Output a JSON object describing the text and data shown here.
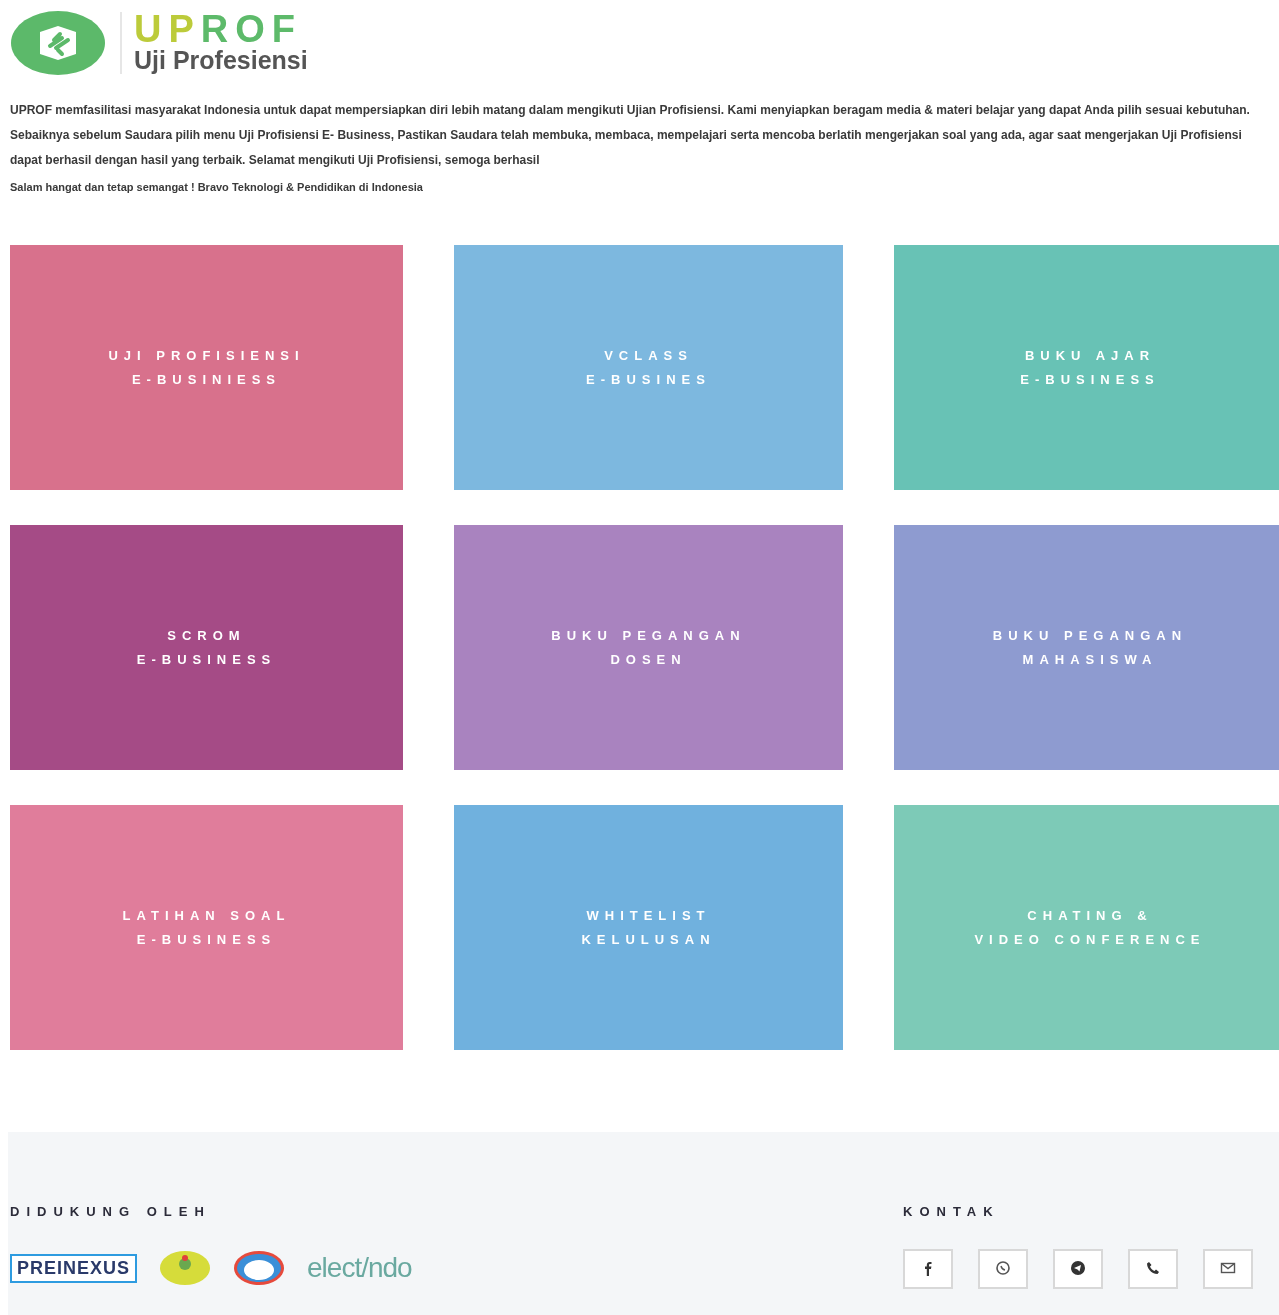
{
  "header": {
    "brand_parts": [
      {
        "text": "UP",
        "color": "#bccb3a"
      },
      {
        "text": "ROF",
        "color": "#5dba6a"
      }
    ],
    "tagline": "Uji Profesiensi"
  },
  "intro": {
    "paragraph": "**UPROF** memfasilitasi masyarakat Indonesia untuk dapat mempersiapkan diri lebih matang dalam mengikuti Ujian Profisiensi. Kami menyiapkan beragam media & materi belajar yang dapat Anda pilih sesuai kebutuhan. Sebaiknya sebelum Saudara pilih menu Uji Profisiensi E- Business, Pastikan Saudara telah membuka, membaca, mempelajari serta mencoba berlatih mengerjakan soal yang ada, agar saat mengerjakan Uji Profisiensi dapat berhasil dengan hasil yang terbaik. Selamat mengikuti Uji Profisiensi, semoga berhasil",
    "greeting": "Salam hangat dan tetap semangat ! Bravo Teknologi & Pendidikan di Indonesia"
  },
  "tiles": [
    {
      "lines": [
        "UJI PROFISIENSI",
        "E-BUSINIESS"
      ],
      "color": "#d8718c"
    },
    {
      "lines": [
        "VCLASS",
        "E-BUSINES"
      ],
      "color": "#7db8df"
    },
    {
      "lines": [
        "BUKU AJAR",
        "E-BUSINESS"
      ],
      "color": "#68c2b5"
    },
    {
      "lines": [
        "SCROM",
        "E-BUSINESS"
      ],
      "color": "#a54b86"
    },
    {
      "lines": [
        "BUKU PEGANGAN",
        "DOSEN"
      ],
      "color": "#a983bf"
    },
    {
      "lines": [
        "BUKU PEGANGAN",
        "MAHASISWA"
      ],
      "color": "#8e9bd0"
    },
    {
      "lines": [
        "LATIHAN SOAL",
        "E-BUSINESS"
      ],
      "color": "#e07d9b"
    },
    {
      "lines": [
        "WHITELIST",
        "KELULUSAN"
      ],
      "color": "#70b1de"
    },
    {
      "lines": [
        "CHATING &",
        "VIDEO CONFERENCE"
      ],
      "color": "#7dcab7"
    }
  ],
  "footer": {
    "supported_heading": "DIDUKUNG OLEH",
    "sponsors": [
      {
        "kind": "wordmark-box",
        "text": "PREINEXUS"
      },
      {
        "kind": "emblem-yellow"
      },
      {
        "kind": "emblem-ring"
      },
      {
        "kind": "wordmark",
        "text": "elect/ndo"
      }
    ],
    "contact_heading": "KONTAK",
    "contacts": [
      {
        "kind": "facebook"
      },
      {
        "kind": "whatsapp"
      },
      {
        "kind": "telegram"
      },
      {
        "kind": "phone"
      },
      {
        "kind": "mail"
      }
    ]
  }
}
